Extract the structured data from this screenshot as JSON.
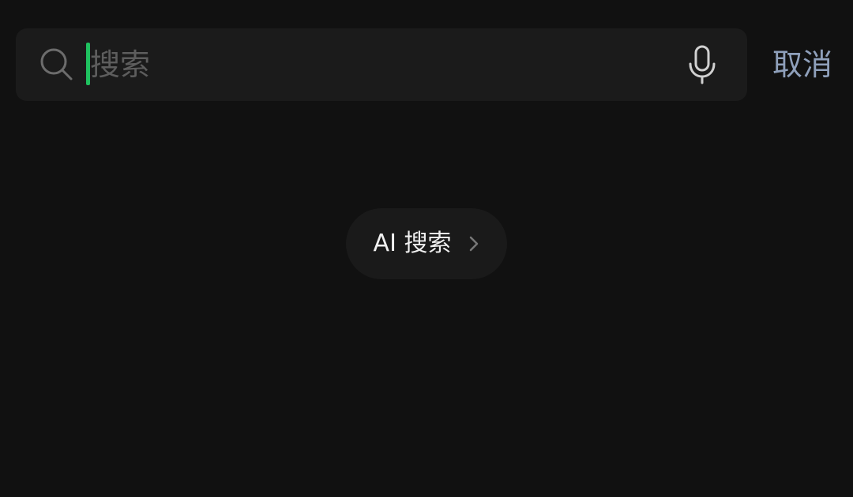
{
  "search": {
    "placeholder": "搜索",
    "value": "",
    "search_icon": "search-icon",
    "mic_icon": "microphone-icon",
    "caret_color": "#1fc15f"
  },
  "header": {
    "cancel_label": "取消"
  },
  "main": {
    "ai_search_label": "AI 搜索",
    "ai_search_icon": "chevron-right-icon"
  },
  "colors": {
    "background": "#111111",
    "search_box": "#1b1b1b",
    "cancel_text": "#8fa0bb",
    "placeholder_text": "#5d5d5d"
  }
}
